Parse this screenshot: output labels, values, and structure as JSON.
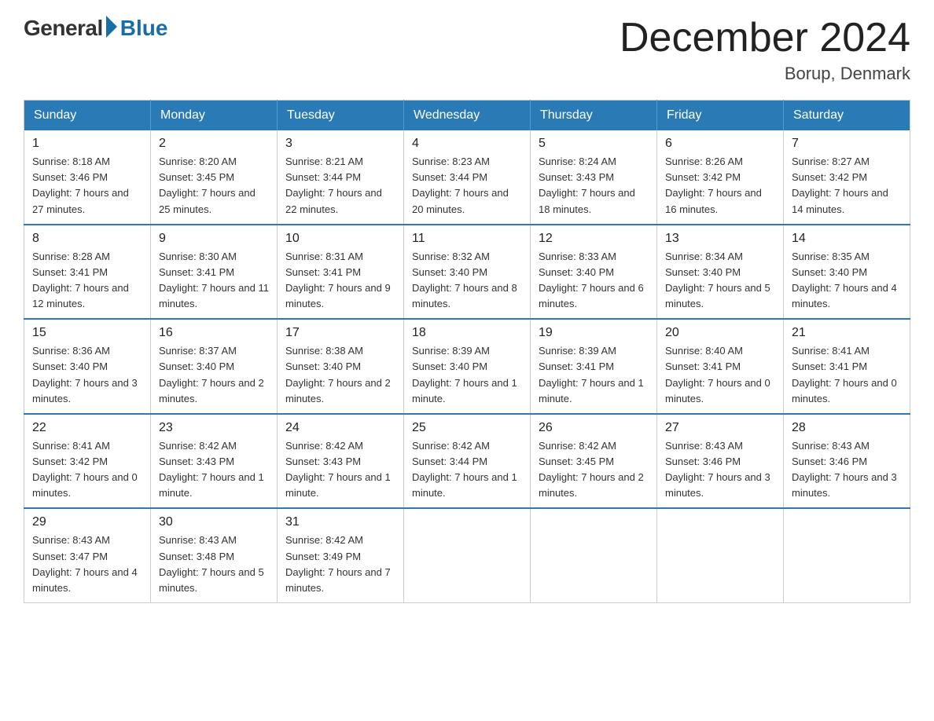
{
  "header": {
    "logo_general": "General",
    "logo_blue": "Blue",
    "title": "December 2024",
    "subtitle": "Borup, Denmark"
  },
  "days_of_week": [
    "Sunday",
    "Monday",
    "Tuesday",
    "Wednesday",
    "Thursday",
    "Friday",
    "Saturday"
  ],
  "weeks": [
    [
      {
        "day": "1",
        "sunrise": "8:18 AM",
        "sunset": "3:46 PM",
        "daylight": "7 hours and 27 minutes."
      },
      {
        "day": "2",
        "sunrise": "8:20 AM",
        "sunset": "3:45 PM",
        "daylight": "7 hours and 25 minutes."
      },
      {
        "day": "3",
        "sunrise": "8:21 AM",
        "sunset": "3:44 PM",
        "daylight": "7 hours and 22 minutes."
      },
      {
        "day": "4",
        "sunrise": "8:23 AM",
        "sunset": "3:44 PM",
        "daylight": "7 hours and 20 minutes."
      },
      {
        "day": "5",
        "sunrise": "8:24 AM",
        "sunset": "3:43 PM",
        "daylight": "7 hours and 18 minutes."
      },
      {
        "day": "6",
        "sunrise": "8:26 AM",
        "sunset": "3:42 PM",
        "daylight": "7 hours and 16 minutes."
      },
      {
        "day": "7",
        "sunrise": "8:27 AM",
        "sunset": "3:42 PM",
        "daylight": "7 hours and 14 minutes."
      }
    ],
    [
      {
        "day": "8",
        "sunrise": "8:28 AM",
        "sunset": "3:41 PM",
        "daylight": "7 hours and 12 minutes."
      },
      {
        "day": "9",
        "sunrise": "8:30 AM",
        "sunset": "3:41 PM",
        "daylight": "7 hours and 11 minutes."
      },
      {
        "day": "10",
        "sunrise": "8:31 AM",
        "sunset": "3:41 PM",
        "daylight": "7 hours and 9 minutes."
      },
      {
        "day": "11",
        "sunrise": "8:32 AM",
        "sunset": "3:40 PM",
        "daylight": "7 hours and 8 minutes."
      },
      {
        "day": "12",
        "sunrise": "8:33 AM",
        "sunset": "3:40 PM",
        "daylight": "7 hours and 6 minutes."
      },
      {
        "day": "13",
        "sunrise": "8:34 AM",
        "sunset": "3:40 PM",
        "daylight": "7 hours and 5 minutes."
      },
      {
        "day": "14",
        "sunrise": "8:35 AM",
        "sunset": "3:40 PM",
        "daylight": "7 hours and 4 minutes."
      }
    ],
    [
      {
        "day": "15",
        "sunrise": "8:36 AM",
        "sunset": "3:40 PM",
        "daylight": "7 hours and 3 minutes."
      },
      {
        "day": "16",
        "sunrise": "8:37 AM",
        "sunset": "3:40 PM",
        "daylight": "7 hours and 2 minutes."
      },
      {
        "day": "17",
        "sunrise": "8:38 AM",
        "sunset": "3:40 PM",
        "daylight": "7 hours and 2 minutes."
      },
      {
        "day": "18",
        "sunrise": "8:39 AM",
        "sunset": "3:40 PM",
        "daylight": "7 hours and 1 minute."
      },
      {
        "day": "19",
        "sunrise": "8:39 AM",
        "sunset": "3:41 PM",
        "daylight": "7 hours and 1 minute."
      },
      {
        "day": "20",
        "sunrise": "8:40 AM",
        "sunset": "3:41 PM",
        "daylight": "7 hours and 0 minutes."
      },
      {
        "day": "21",
        "sunrise": "8:41 AM",
        "sunset": "3:41 PM",
        "daylight": "7 hours and 0 minutes."
      }
    ],
    [
      {
        "day": "22",
        "sunrise": "8:41 AM",
        "sunset": "3:42 PM",
        "daylight": "7 hours and 0 minutes."
      },
      {
        "day": "23",
        "sunrise": "8:42 AM",
        "sunset": "3:43 PM",
        "daylight": "7 hours and 1 minute."
      },
      {
        "day": "24",
        "sunrise": "8:42 AM",
        "sunset": "3:43 PM",
        "daylight": "7 hours and 1 minute."
      },
      {
        "day": "25",
        "sunrise": "8:42 AM",
        "sunset": "3:44 PM",
        "daylight": "7 hours and 1 minute."
      },
      {
        "day": "26",
        "sunrise": "8:42 AM",
        "sunset": "3:45 PM",
        "daylight": "7 hours and 2 minutes."
      },
      {
        "day": "27",
        "sunrise": "8:43 AM",
        "sunset": "3:46 PM",
        "daylight": "7 hours and 3 minutes."
      },
      {
        "day": "28",
        "sunrise": "8:43 AM",
        "sunset": "3:46 PM",
        "daylight": "7 hours and 3 minutes."
      }
    ],
    [
      {
        "day": "29",
        "sunrise": "8:43 AM",
        "sunset": "3:47 PM",
        "daylight": "7 hours and 4 minutes."
      },
      {
        "day": "30",
        "sunrise": "8:43 AM",
        "sunset": "3:48 PM",
        "daylight": "7 hours and 5 minutes."
      },
      {
        "day": "31",
        "sunrise": "8:42 AM",
        "sunset": "3:49 PM",
        "daylight": "7 hours and 7 minutes."
      },
      null,
      null,
      null,
      null
    ]
  ]
}
